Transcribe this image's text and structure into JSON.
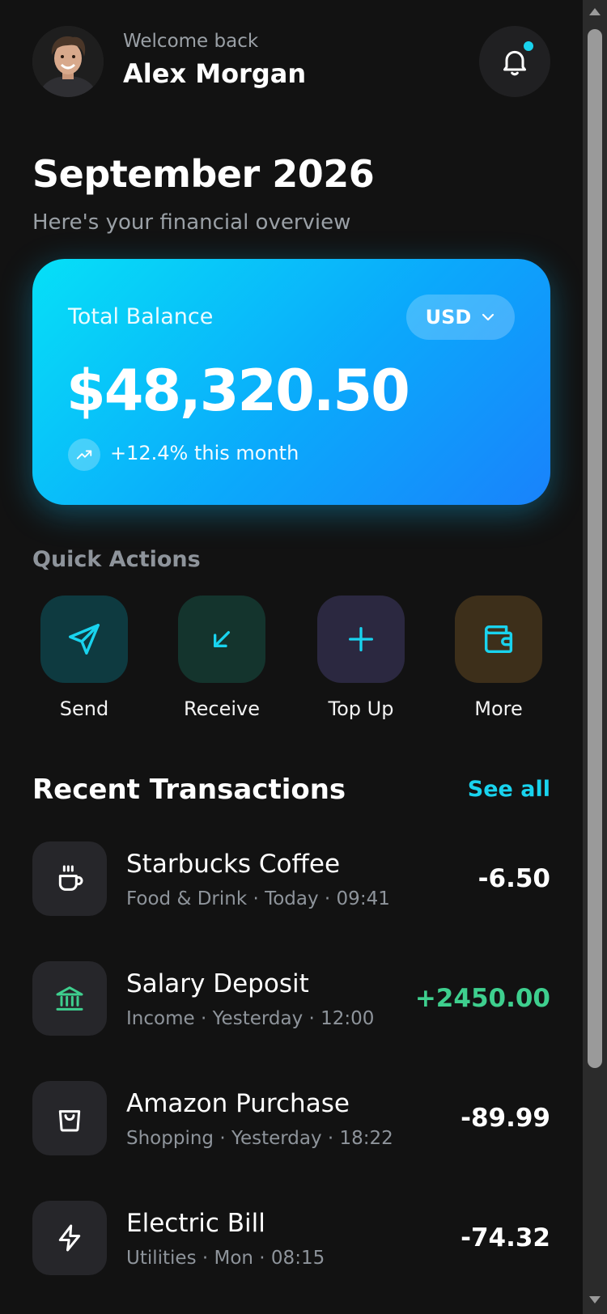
{
  "header": {
    "welcome": "Welcome back",
    "user_name": "Alex Morgan",
    "avatar_icon": "user-avatar",
    "notification_icon": "bell-icon",
    "notification_dot_color": "#19d3ee"
  },
  "period": {
    "title": "September 2026",
    "subtitle": "Here's your financial overview"
  },
  "balance_card": {
    "label": "Total Balance",
    "currency": "USD",
    "amount": "$48,320.50",
    "trend_text": "+12.4% this month",
    "gradient_start": "#06e0f7",
    "gradient_end": "#1982fb"
  },
  "quick_actions": {
    "title": "Quick Actions",
    "items": [
      {
        "label": "Send",
        "icon": "send-icon",
        "bg": "#0e3a40",
        "color": "#19d3ee"
      },
      {
        "label": "Receive",
        "icon": "arrow-down-left-icon",
        "bg": "#14342d",
        "color": "#19d3ee"
      },
      {
        "label": "Top Up",
        "icon": "plus-icon",
        "bg": "#2b2840",
        "color": "#19d3ee"
      },
      {
        "label": "More",
        "icon": "wallet-icon",
        "bg": "#3d2f1a",
        "color": "#19d3ee"
      }
    ]
  },
  "transactions": {
    "title": "Recent Transactions",
    "see_all": "See all",
    "items": [
      {
        "name": "Starbucks Coffee",
        "meta": "Food & Drink · Today · 09:41",
        "amount": "-6.50",
        "icon": "coffee-icon",
        "icon_color": "#ffffff"
      },
      {
        "name": "Salary Deposit",
        "meta": "Income · Yesterday · 12:00",
        "amount": "+2450.00",
        "icon": "bank-icon",
        "icon_color": "#3ecf8e"
      },
      {
        "name": "Amazon Purchase",
        "meta": "Shopping · Yesterday · 18:22",
        "amount": "-89.99",
        "icon": "shopping-bag-icon",
        "icon_color": "#ffffff"
      },
      {
        "name": "Electric Bill",
        "meta": "Utilities · Mon · 08:15",
        "amount": "-74.32",
        "icon": "lightning-icon",
        "icon_color": "#ffffff"
      }
    ]
  },
  "colors": {
    "background": "#121212",
    "accent": "#19d3ee",
    "positive": "#3ecf8e",
    "muted_text": "#9aa0a6"
  }
}
